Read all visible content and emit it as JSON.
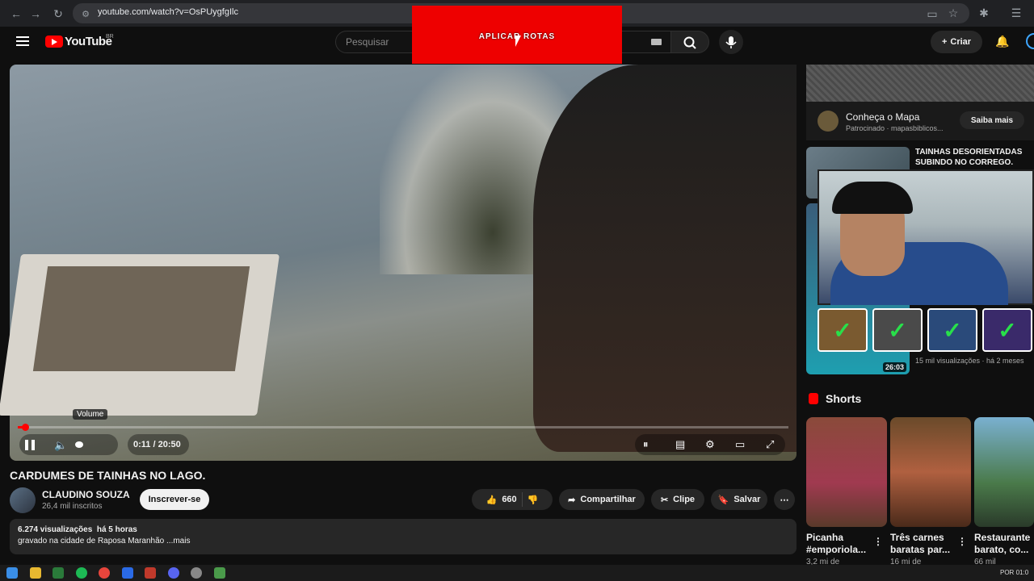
{
  "browser": {
    "url": "youtube.com/watch?v=OsPUygfgIlc"
  },
  "header": {
    "logo_text": "YouTube",
    "country": "BR",
    "search_placeholder": "Pesquisar",
    "create_label": "Criar",
    "overlay_banner": "APLICAR ROTAS"
  },
  "player": {
    "tooltip": "Volume",
    "time": "0:11 / 20:50",
    "progress_fraction": 0.009
  },
  "video": {
    "title": "CARDUMES DE TAINHAS NO LAGO.",
    "channel": "CLAUDINO SOUZA",
    "subscribers": "26,4 mil inscritos",
    "subscribe_label": "Inscrever-se",
    "likes": "660",
    "share_label": "Compartilhar",
    "clip_label": "Clipe",
    "save_label": "Salvar",
    "views_time": "6.274 visualizações  há 5 horas",
    "description": "gravado na cidade de Raposa Maranhão ...mais"
  },
  "sidebar": {
    "ad": {
      "title": "Conheça o Mapa",
      "sponsor": "Patrocinado · mapasbiblicos...",
      "button": "Saiba mais"
    },
    "recommendations": [
      {
        "title": "TAINHAS DESORIENTADAS SUBINDO NO CORREGO."
      },
      {
        "duration": "26:03",
        "meta": "15 mil visualizações · há 2 meses"
      }
    ],
    "shorts_label": "Shorts",
    "shorts": [
      {
        "title": "Picanha #emporiola...",
        "views": "3,2 mi de"
      },
      {
        "title": "Três carnes baratas par...",
        "views": "16 mi de"
      },
      {
        "title": "Restaurante barato, co...",
        "views": "66 mil"
      }
    ]
  },
  "taskbar": {
    "lang": "POR",
    "clock": "01:0"
  }
}
